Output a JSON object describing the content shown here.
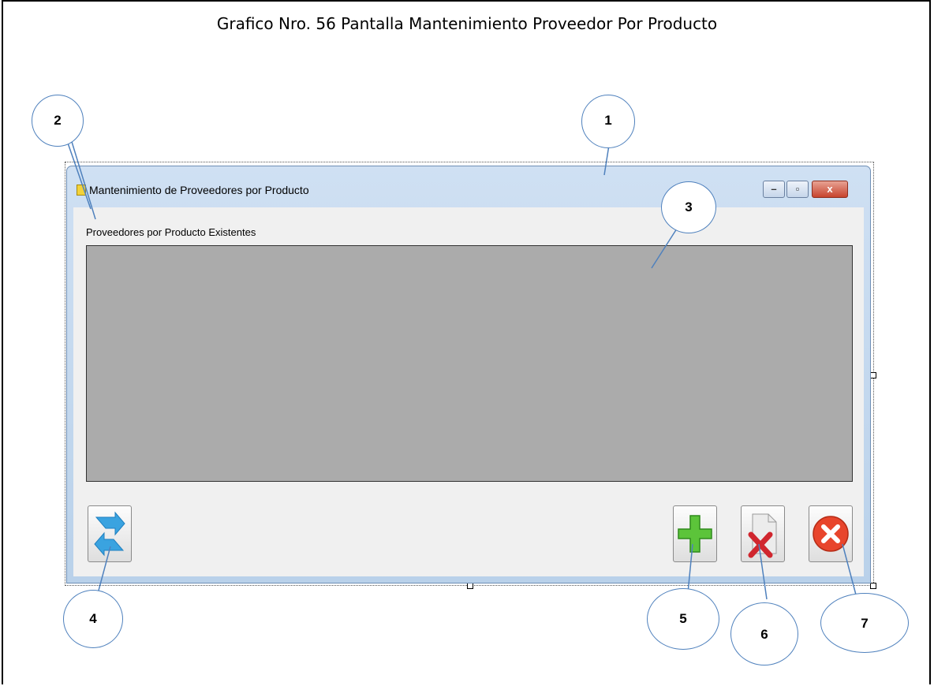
{
  "figure": {
    "caption": "Grafico Nro. 56 Pantalla Mantenimiento Proveedor Por Producto"
  },
  "window": {
    "title": "Mantenimiento de Proveedores por Producto",
    "controls": {
      "minimize": "–",
      "maximize": "▫",
      "close": "x"
    }
  },
  "form": {
    "grid_label": "Proveedores por Producto Existentes"
  },
  "toolbar": {
    "refresh_icon": "refresh-arrows-icon",
    "add_icon": "green-plus-icon",
    "delete_icon": "document-delete-icon",
    "exit_icon": "red-circle-x-icon"
  },
  "callouts": [
    "1",
    "2",
    "3",
    "4",
    "5",
    "6",
    "7"
  ],
  "colors": {
    "accent_callout": "#4f81bd",
    "grid_background": "#ababab",
    "title_bar": "#c4d9ef"
  }
}
